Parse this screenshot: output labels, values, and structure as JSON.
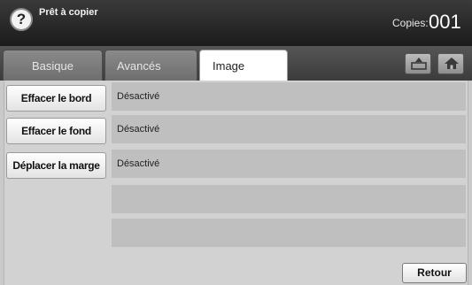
{
  "header": {
    "help_symbol": "?",
    "status": "Prêt à copier",
    "copies_label": "Copies:",
    "copies_value": "001"
  },
  "tabs": [
    {
      "label": "Basique",
      "active": false
    },
    {
      "label": "Avancés",
      "active": false
    },
    {
      "label": "Image",
      "active": true
    }
  ],
  "toolbar": {
    "icons": [
      "tray-eject-icon",
      "home-icon"
    ]
  },
  "settings": [
    {
      "button": "Effacer le bord",
      "value": "Désactivé"
    },
    {
      "button": "Effacer le fond",
      "value": "Désactivé"
    },
    {
      "button": "Déplacer la marge",
      "value": "Désactivé"
    }
  ],
  "footer": {
    "back_label": "Retour"
  }
}
